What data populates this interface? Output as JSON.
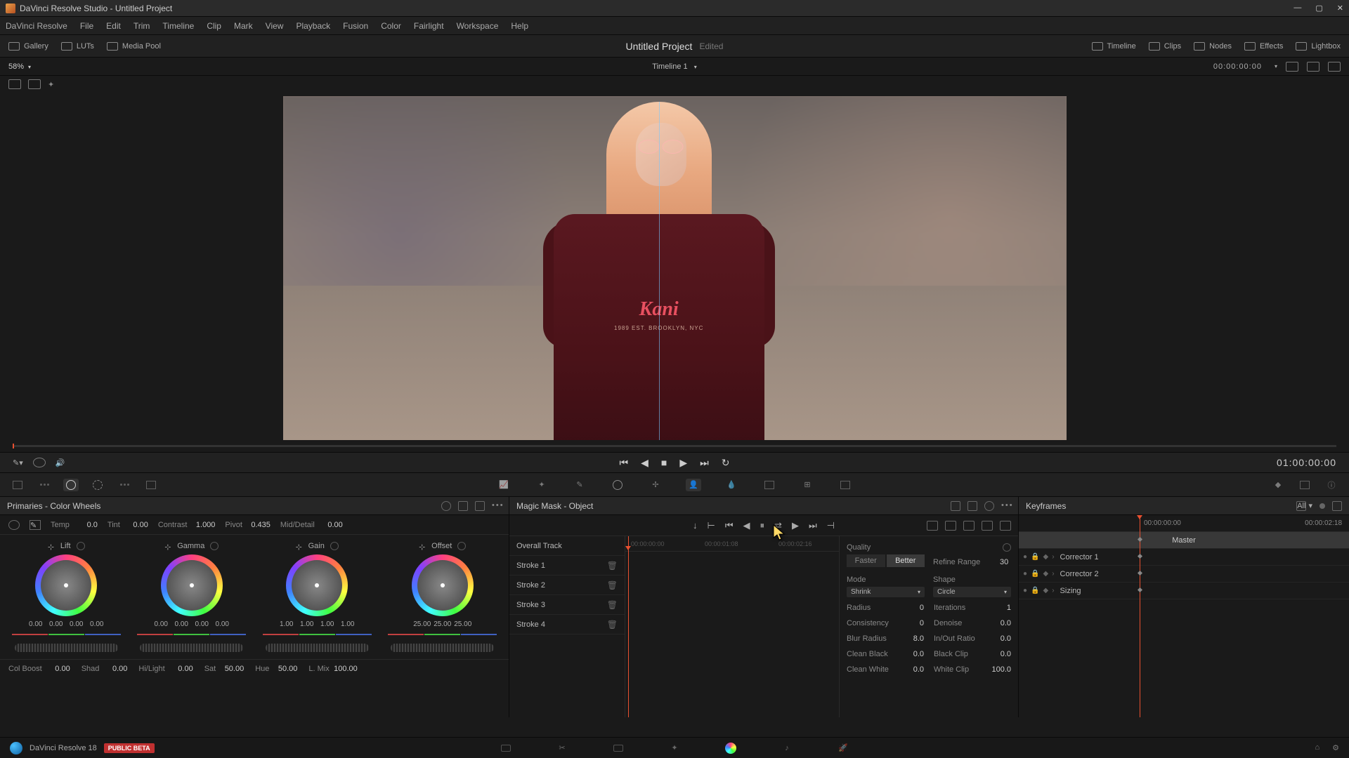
{
  "title_bar": "DaVinci Resolve Studio - Untitled Project",
  "menu": [
    "DaVinci Resolve",
    "File",
    "Edit",
    "Trim",
    "Timeline",
    "Clip",
    "Mark",
    "View",
    "Playback",
    "Fusion",
    "Color",
    "Fairlight",
    "Workspace",
    "Help"
  ],
  "toolbar_left": [
    {
      "label": "Gallery"
    },
    {
      "label": "LUTs"
    },
    {
      "label": "Media Pool"
    }
  ],
  "project_name": "Untitled Project",
  "project_status": "Edited",
  "toolbar_right": [
    {
      "label": "Timeline"
    },
    {
      "label": "Clips"
    },
    {
      "label": "Nodes"
    },
    {
      "label": "Effects"
    },
    {
      "label": "Lightbox"
    }
  ],
  "zoom": "58%",
  "timeline_name": "Timeline 1",
  "timecode_top": "00:00:00:00",
  "timecode_main": "01:00:00:00",
  "shirt_brand": "Kani",
  "shirt_sub": "1989 EST. BROOKLYN, NYC",
  "primaries": {
    "title": "Primaries - Color Wheels",
    "params_top": [
      {
        "label": "Temp",
        "value": "0.0"
      },
      {
        "label": "Tint",
        "value": "0.00"
      },
      {
        "label": "Contrast",
        "value": "1.000"
      },
      {
        "label": "Pivot",
        "value": "0.435"
      },
      {
        "label": "Mid/Detail",
        "value": "0.00"
      }
    ],
    "wheels": [
      {
        "name": "Lift",
        "vals": [
          "0.00",
          "0.00",
          "0.00",
          "0.00"
        ]
      },
      {
        "name": "Gamma",
        "vals": [
          "0.00",
          "0.00",
          "0.00",
          "0.00"
        ]
      },
      {
        "name": "Gain",
        "vals": [
          "1.00",
          "1.00",
          "1.00",
          "1.00"
        ]
      },
      {
        "name": "Offset",
        "vals": [
          "25.00",
          "25.00",
          "25.00"
        ]
      }
    ],
    "params_bottom": [
      {
        "label": "Col Boost",
        "value": "0.00"
      },
      {
        "label": "Shad",
        "value": "0.00"
      },
      {
        "label": "Hi/Light",
        "value": "0.00"
      },
      {
        "label": "Sat",
        "value": "50.00"
      },
      {
        "label": "Hue",
        "value": "50.00"
      },
      {
        "label": "L. Mix",
        "value": "100.00"
      }
    ]
  },
  "magic_mask": {
    "title": "Magic Mask - Object",
    "tracks": [
      "Overall Track",
      "Stroke 1",
      "Stroke 2",
      "Stroke 3",
      "Stroke 4"
    ],
    "timeline_tc": [
      "00:00:00:00",
      "00:00:01:08",
      "00:00:02:16"
    ],
    "quality_label": "Quality",
    "quality": [
      "Faster",
      "Better"
    ],
    "quality_active": "Better",
    "refine": {
      "label": "Refine Range",
      "value": "30"
    },
    "mode_label": "Mode",
    "shape_label": "Shape",
    "mode_select": "Shrink",
    "shape_select": "Circle",
    "props": [
      {
        "l": "Radius",
        "v": "0",
        "l2": "Iterations",
        "v2": "1"
      },
      {
        "l": "Consistency",
        "v": "0",
        "l2": "Denoise",
        "v2": "0.0"
      },
      {
        "l": "Blur Radius",
        "v": "8.0",
        "l2": "In/Out Ratio",
        "v2": "0.0"
      },
      {
        "l": "Clean Black",
        "v": "0.0",
        "l2": "Black Clip",
        "v2": "0.0"
      },
      {
        "l": "Clean White",
        "v": "0.0",
        "l2": "White Clip",
        "v2": "100.0"
      }
    ]
  },
  "keyframes": {
    "title": "Keyframes",
    "filter": "All",
    "tc": [
      "00:00:00:00",
      "00:00:02:18"
    ],
    "master": "Master",
    "rows": [
      "Corrector 1",
      "Corrector 2",
      "Sizing"
    ]
  },
  "footer": {
    "app": "DaVinci Resolve 18",
    "badge": "PUBLIC BETA"
  }
}
